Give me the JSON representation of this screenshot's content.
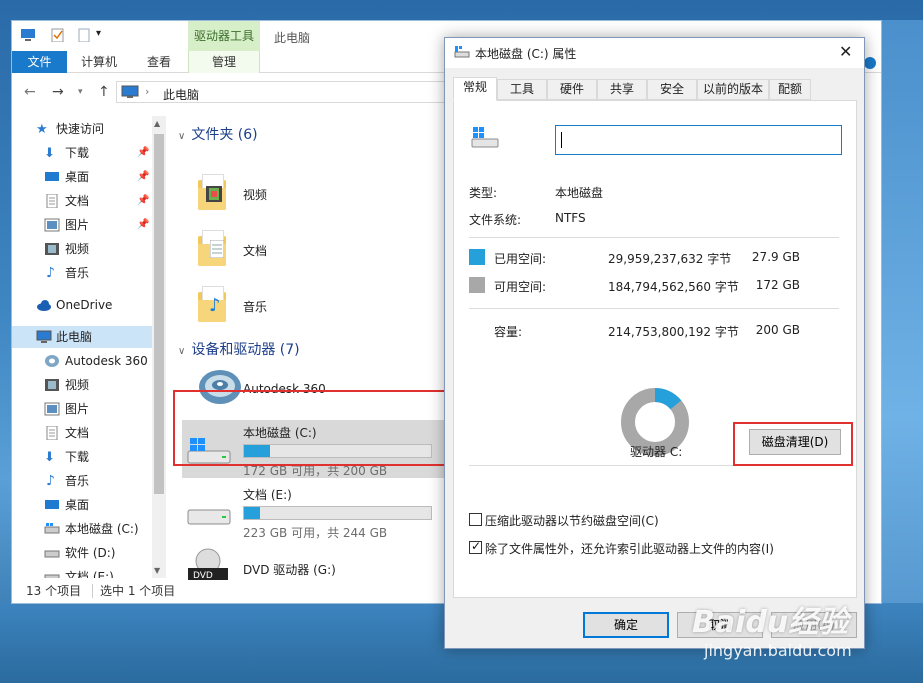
{
  "explorer": {
    "quick_access_toolbar": [
      "computer-icon",
      "properties-icon",
      "new-folder-icon",
      "customize-qat-icon"
    ],
    "contextual_header": "驱动器工具",
    "window_title": "此电脑",
    "ribbon_tabs": [
      "文件",
      "计算机",
      "查看",
      "管理"
    ],
    "address": {
      "path": "此电脑"
    },
    "sidebar": [
      {
        "label": "快速访问",
        "icon": "star-icon",
        "pinned": false
      },
      {
        "label": "下载",
        "icon": "download-icon",
        "pinned": true
      },
      {
        "label": "桌面",
        "icon": "desktop-icon",
        "pinned": true
      },
      {
        "label": "文档",
        "icon": "document-icon",
        "pinned": true
      },
      {
        "label": "图片",
        "icon": "picture-icon",
        "pinned": true
      },
      {
        "label": "视频",
        "icon": "video-icon",
        "pinned": false
      },
      {
        "label": "音乐",
        "icon": "music-icon",
        "pinned": false
      },
      {
        "label": "OneDrive",
        "icon": "cloud-icon",
        "pinned": false
      },
      {
        "label": "此电脑",
        "icon": "computer-icon",
        "pinned": false,
        "selected": true
      },
      {
        "label": "Autodesk 360",
        "icon": "autodesk-icon",
        "pinned": false
      },
      {
        "label": "视频",
        "icon": "video-icon",
        "pinned": false
      },
      {
        "label": "图片",
        "icon": "picture-icon",
        "pinned": false
      },
      {
        "label": "文档",
        "icon": "document-icon",
        "pinned": false
      },
      {
        "label": "下载",
        "icon": "download-icon",
        "pinned": false
      },
      {
        "label": "音乐",
        "icon": "music-icon",
        "pinned": false
      },
      {
        "label": "桌面",
        "icon": "desktop-icon",
        "pinned": false
      },
      {
        "label": "本地磁盘 (C:)",
        "icon": "drive-icon",
        "pinned": false
      },
      {
        "label": "软件 (D:)",
        "icon": "drive-icon",
        "pinned": false
      },
      {
        "label": "文档 (E:)",
        "icon": "drive-icon",
        "pinned": false
      }
    ],
    "folders_header": "文件夹 (6)",
    "folders": [
      {
        "name": "视频",
        "icon": "video-folder-icon"
      },
      {
        "name": "文档",
        "icon": "document-folder-icon"
      },
      {
        "name": "音乐",
        "icon": "music-folder-icon"
      }
    ],
    "devices_header": "设备和驱动器 (7)",
    "devices": [
      {
        "name": "Autodesk 360",
        "icon": "autodesk-icon"
      }
    ],
    "drives": [
      {
        "name": "本地磁盘 (C:)",
        "free_text": "172 GB 可用，共 200 GB",
        "used_fraction": 0.14,
        "selected": true
      },
      {
        "name": "文档 (E:)",
        "free_text": "223 GB 可用，共 244 GB",
        "used_fraction": 0.086,
        "selected": false
      },
      {
        "name": "DVD 驱动器 (G:)",
        "free_text": "",
        "used_fraction": null,
        "selected": false
      }
    ],
    "status": {
      "count": "13 个项目",
      "selected": "选中 1 个项目"
    }
  },
  "dialog": {
    "title": "本地磁盘 (C:) 属性",
    "tabs": [
      "常规",
      "工具",
      "硬件",
      "共享",
      "安全",
      "以前的版本",
      "配额"
    ],
    "active_tab": "常规",
    "name_value": "",
    "type_label": "类型:",
    "type_value": "本地磁盘",
    "fs_label": "文件系统:",
    "fs_value": "NTFS",
    "used": {
      "label": "已用空间:",
      "bytes": "29,959,237,632 字节",
      "gb": "27.9 GB",
      "color": "#26a0da"
    },
    "free": {
      "label": "可用空间:",
      "bytes": "184,794,562,560 字节",
      "gb": "172 GB",
      "color": "#a8a8a8"
    },
    "capacity": {
      "label": "容量:",
      "bytes": "214,753,800,192 字节",
      "gb": "200 GB"
    },
    "used_fraction": 0.14,
    "drive_label": "驱动器 C:",
    "cleanup_button": "磁盘清理(D)",
    "checkboxes": [
      {
        "label": "压缩此驱动器以节约磁盘空间(C)",
        "checked": false
      },
      {
        "label": "除了文件属性外，还允许索引此驱动器上文件的内容(I)",
        "checked": true
      }
    ],
    "buttons": {
      "ok": "确定",
      "cancel": "取消",
      "apply": "应用(A)"
    }
  },
  "watermark": {
    "brand": "Baidu经验",
    "url": "jingyan.baidu.com"
  }
}
